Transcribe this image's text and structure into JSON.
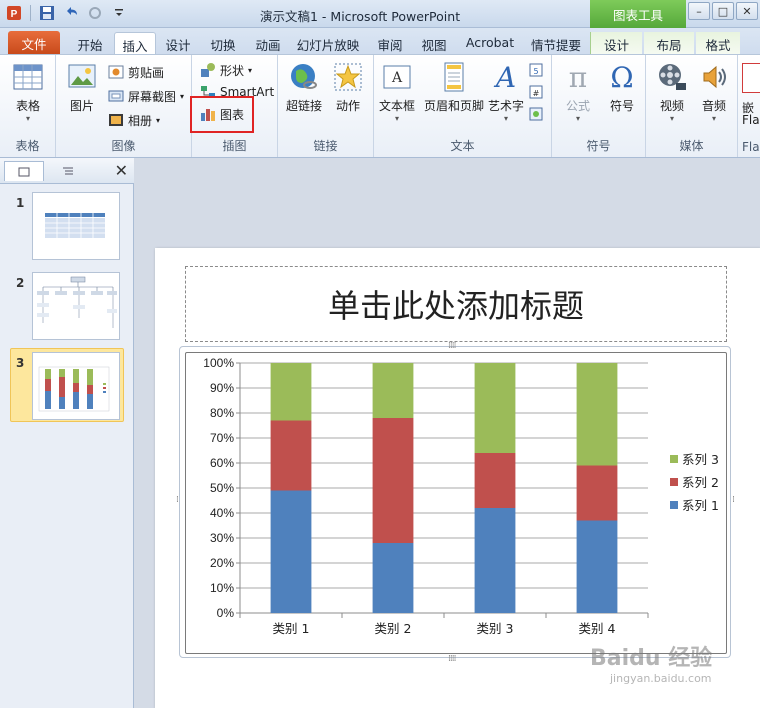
{
  "window": {
    "title": "演示文稿1 - Microsoft PowerPoint",
    "context_tools": "图表工具",
    "controls": [
      "–",
      "□",
      "✕"
    ]
  },
  "tabs": [
    {
      "label": "文件"
    },
    {
      "label": "开始"
    },
    {
      "label": "插入"
    },
    {
      "label": "设计"
    },
    {
      "label": "切换"
    },
    {
      "label": "动画"
    },
    {
      "label": "幻灯片放映"
    },
    {
      "label": "审阅"
    },
    {
      "label": "视图"
    },
    {
      "label": "Acrobat"
    },
    {
      "label": "情节提要"
    },
    {
      "label": "设计"
    },
    {
      "label": "布局"
    },
    {
      "label": "格式"
    }
  ],
  "ribbon": {
    "groups": {
      "table": "表格",
      "images": "图像",
      "illustrations": "插图",
      "links": "链接",
      "text": "文本",
      "symbols": "符号",
      "media": "媒体",
      "flash": "Fla"
    },
    "buttons": {
      "table": "表格",
      "picture": "图片",
      "clipart": "剪贴画",
      "screenshot": "屏幕截图",
      "album": "相册",
      "shapes": "形状",
      "smartart": "SmartArt",
      "chart": "图表",
      "hyperlink": "超链接",
      "action": "动作",
      "textbox": "文本框",
      "header_footer": "页眉和页脚",
      "wordart": "艺术字",
      "equation": "公式",
      "symbol": "符号",
      "video": "视频",
      "audio": "音频",
      "flash_cut": "嵌",
      "flash_cut2": "Fla"
    },
    "highlight_color": "#e02424"
  },
  "slides_panel": {
    "slides": [
      {
        "number": "1"
      },
      {
        "number": "2"
      },
      {
        "number": "3"
      }
    ],
    "selected": 3
  },
  "slide": {
    "title_placeholder": "单击此处添加标题"
  },
  "chart_data": {
    "type": "bar",
    "stacked": "percent",
    "categories": [
      "类别 1",
      "类别 2",
      "类别 3",
      "类别 4"
    ],
    "series": [
      {
        "name": "系列 1",
        "color": "#4f81bd",
        "values": [
          49,
          28,
          42,
          37
        ]
      },
      {
        "name": "系列 2",
        "color": "#c0504d",
        "values": [
          28,
          50,
          22,
          22
        ]
      },
      {
        "name": "系列 3",
        "color": "#9bbb59",
        "values": [
          23,
          22,
          36,
          41
        ]
      }
    ],
    "yticks": [
      "0%",
      "10%",
      "20%",
      "30%",
      "40%",
      "50%",
      "60%",
      "70%",
      "80%",
      "90%",
      "100%"
    ],
    "ylim": [
      0,
      100
    ],
    "grid": true,
    "legend": "right"
  },
  "watermark": {
    "brand": "Baidu 经验",
    "url": "jingyan.baidu.com"
  }
}
